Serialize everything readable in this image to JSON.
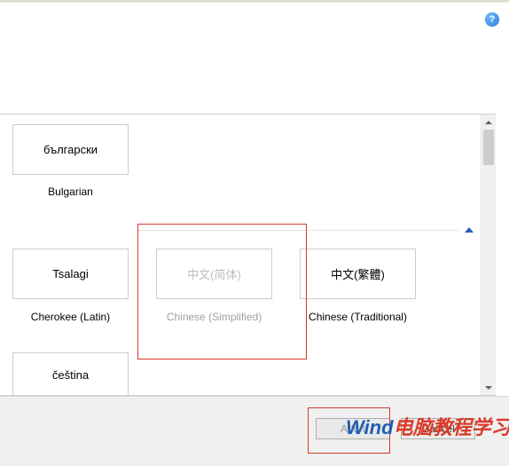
{
  "helpGlyph": "?",
  "languages": {
    "bulgarian": {
      "native": "български",
      "english": "Bulgarian"
    },
    "cherokee": {
      "native": "Tsalagi",
      "english": "Cherokee (Latin)"
    },
    "chineseSimplified": {
      "native": "中文(简体)",
      "english": "Chinese (Simplified)"
    },
    "chineseTraditional": {
      "native": "中文(繁體)",
      "english": "Chinese (Traditional)"
    },
    "czech": {
      "native": "čeština"
    }
  },
  "buttons": {
    "addVisible": "Add t",
    "cancelVisible": "Cancel"
  },
  "watermark": {
    "part1": "Wind",
    "part2": "电脑教程学习网"
  }
}
